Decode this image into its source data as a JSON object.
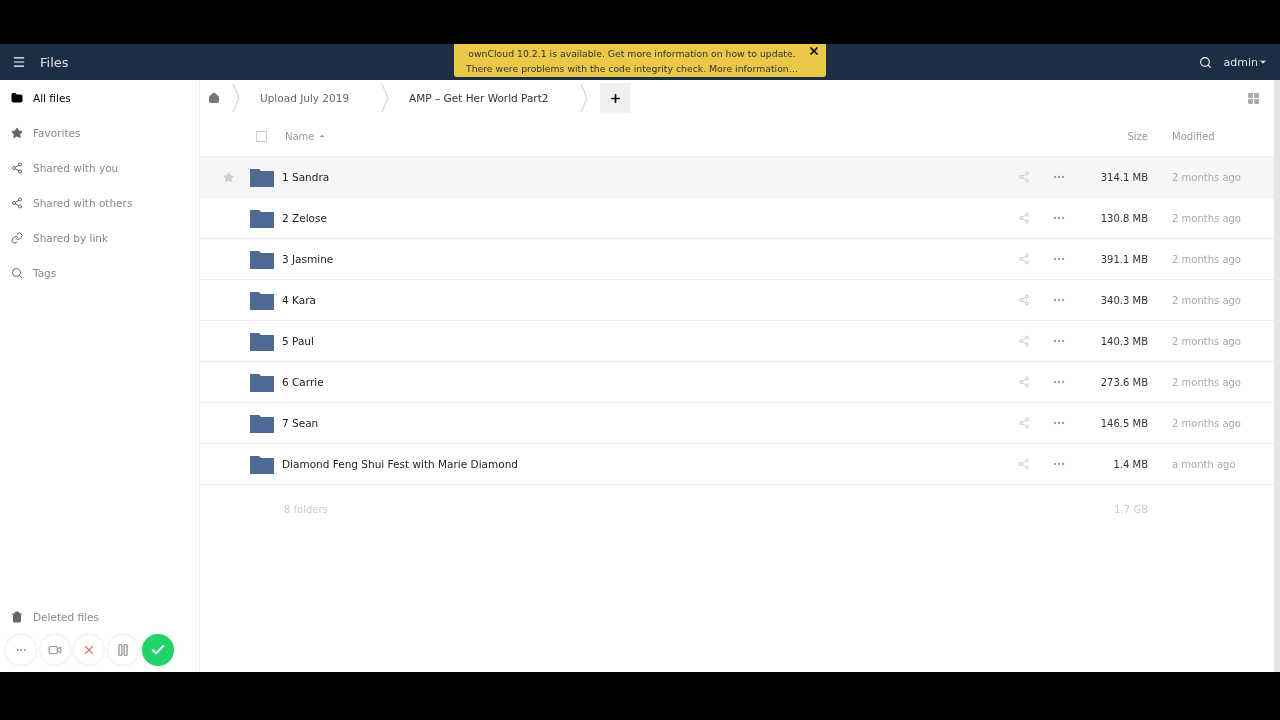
{
  "header": {
    "app_title": "Files",
    "user": "admin"
  },
  "notification": {
    "lines": [
      "ownCloud 10.2.1 is available. Get more information on how to update.",
      "There were problems with the code integrity check. More information…"
    ]
  },
  "sidebar": {
    "items": [
      {
        "label": "All files",
        "kind": "folder",
        "selected": true
      },
      {
        "label": "Favorites",
        "kind": "star",
        "selected": false
      },
      {
        "label": "Shared with you",
        "kind": "share",
        "selected": false
      },
      {
        "label": "Shared with others",
        "kind": "share",
        "selected": false
      },
      {
        "label": "Shared by link",
        "kind": "link",
        "selected": false
      },
      {
        "label": "Tags",
        "kind": "tag",
        "selected": false
      }
    ],
    "footer_item": {
      "label": "Deleted files"
    }
  },
  "breadcrumbs": [
    "Upload July 2019",
    "AMP – Get Her World Part2"
  ],
  "table": {
    "select_all": {
      "checked": false
    },
    "columns": [
      "Name",
      "Size",
      "Modified"
    ],
    "rows": [
      {
        "name": "1 Sandra",
        "size": "314.1 MB",
        "modified": "2 months ago",
        "hovered": true
      },
      {
        "name": "2 Zelose",
        "size": "130.8 MB",
        "modified": "2 months ago",
        "hovered": false
      },
      {
        "name": "3 Jasmine",
        "size": "391.1 MB",
        "modified": "2 months ago",
        "hovered": false
      },
      {
        "name": "4 Kara",
        "size": "340.3 MB",
        "modified": "2 months ago",
        "hovered": false
      },
      {
        "name": "5 Paul",
        "size": "140.3 MB",
        "modified": "2 months ago",
        "hovered": false
      },
      {
        "name": "6 Carrie",
        "size": "273.6 MB",
        "modified": "2 months ago",
        "hovered": false
      },
      {
        "name": "7 Sean",
        "size": "146.5 MB",
        "modified": "2 months ago",
        "hovered": false
      },
      {
        "name": "Diamond Feng Shui Fest with Marie Diamond",
        "size": "1.4 MB",
        "modified": "a month ago",
        "hovered": false
      }
    ],
    "summary": {
      "count": "8 folders",
      "total": "1.7 GB"
    }
  }
}
